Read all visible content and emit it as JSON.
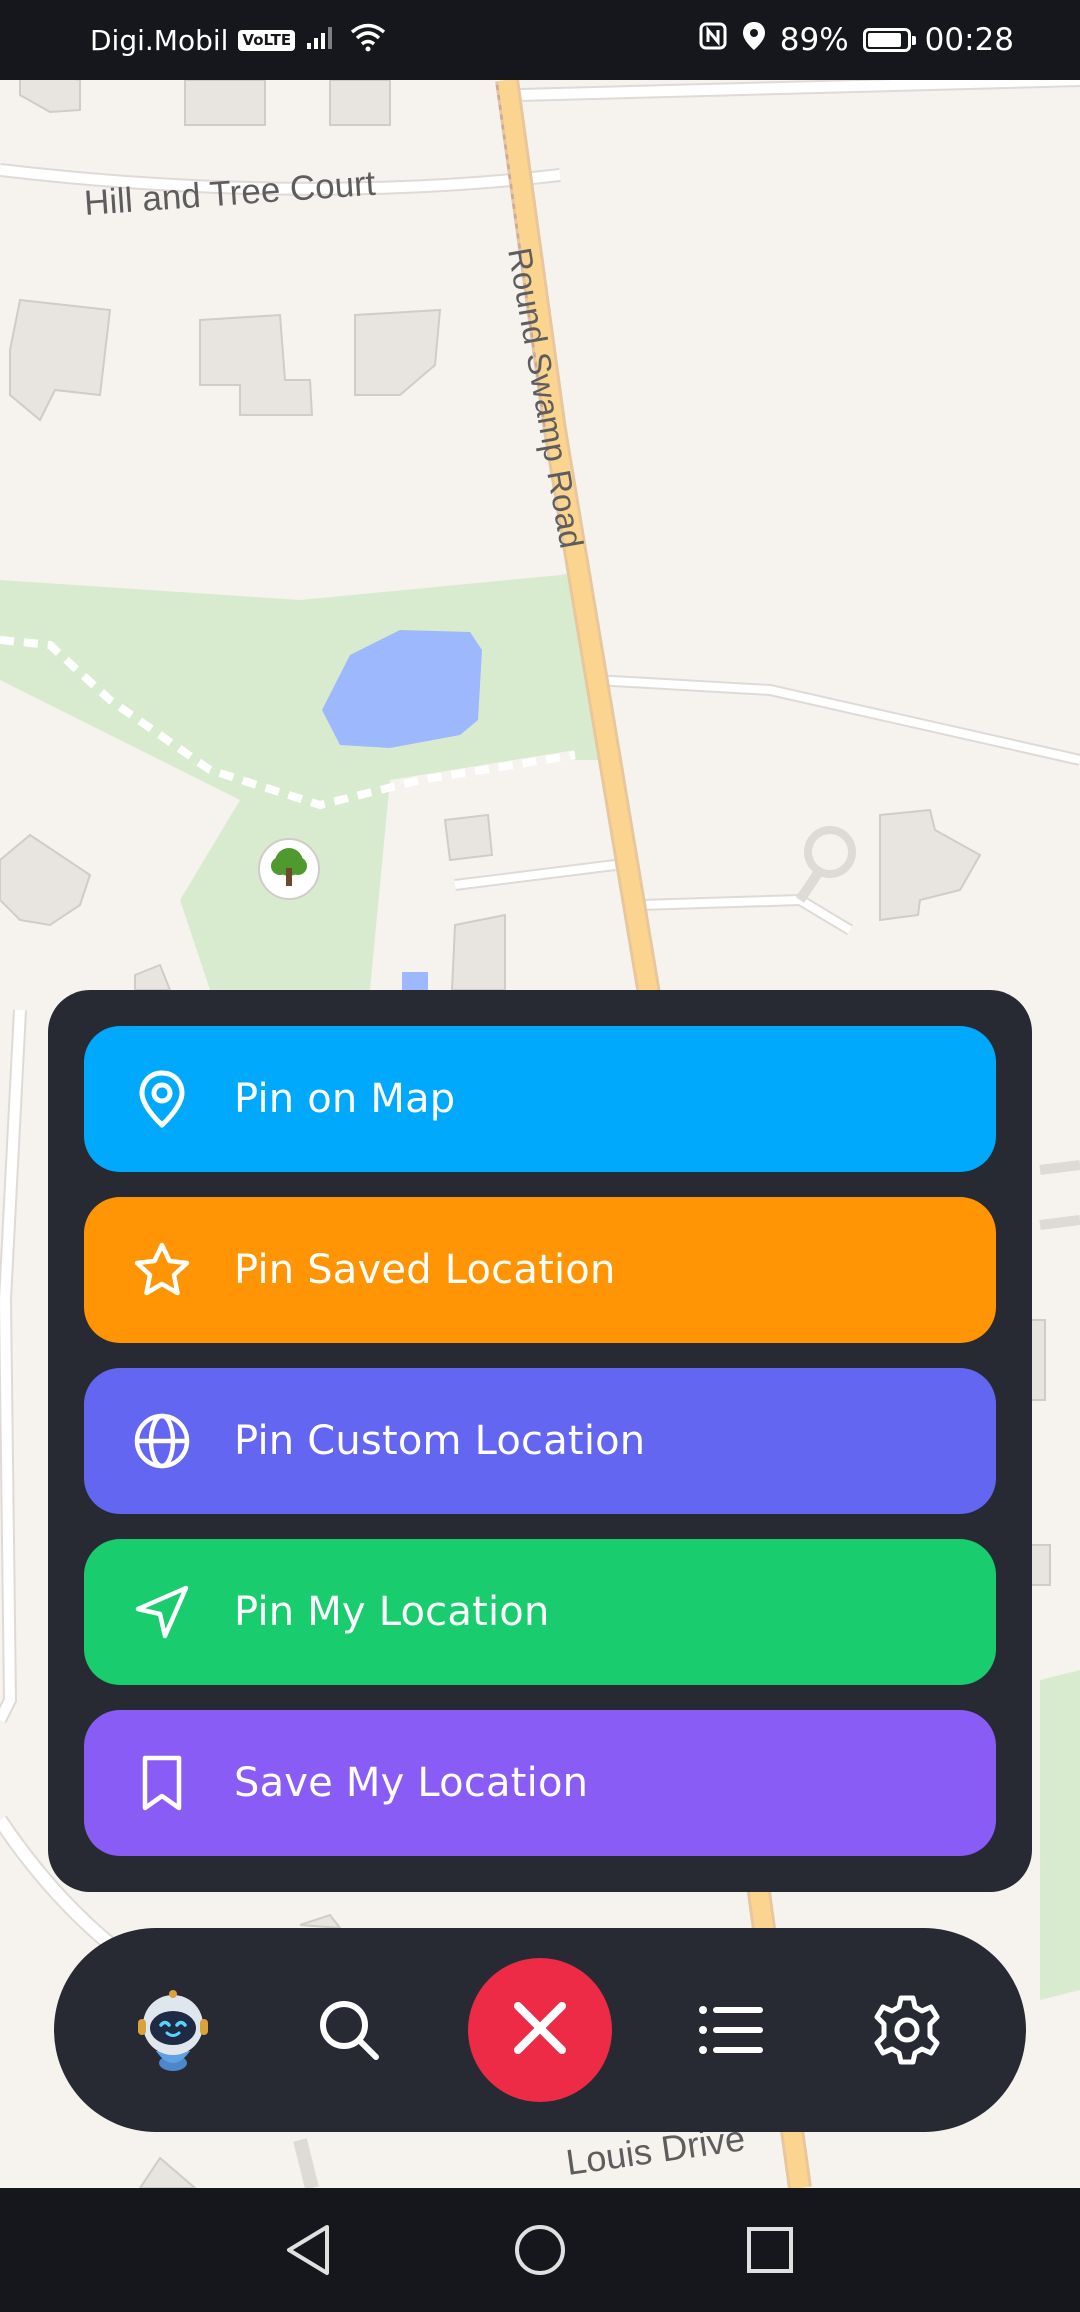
{
  "status_bar": {
    "carrier": "Digi.Mobil",
    "volte": "VoLTE",
    "battery_percent": "89%",
    "battery_level": 0.89,
    "time": "00:28"
  },
  "map": {
    "streets": [
      "Hill and Tree Court",
      "Round Swamp Road",
      "Louis Drive"
    ],
    "park_icon": "tree-icon"
  },
  "action_menu": {
    "items": [
      {
        "label": "Pin on Map",
        "icon": "location-pin-icon",
        "color": "#00a9fb"
      },
      {
        "label": "Pin Saved Location",
        "icon": "star-icon",
        "color": "#ff9404"
      },
      {
        "label": "Pin Custom Location",
        "icon": "globe-icon",
        "color": "#6366f1"
      },
      {
        "label": "Pin My Location",
        "icon": "navigation-arrow-icon",
        "color": "#19cd6e"
      },
      {
        "label": "Save My Location",
        "icon": "bookmark-icon",
        "color": "#8a5cf6"
      }
    ]
  },
  "bottom_bar": {
    "items": [
      "robot-assistant-icon",
      "search-icon",
      "close-icon",
      "list-icon",
      "gear-icon"
    ],
    "close_color": "#ee2b47"
  },
  "nav_bar": {
    "items": [
      "back-icon",
      "home-icon",
      "recents-icon"
    ]
  }
}
